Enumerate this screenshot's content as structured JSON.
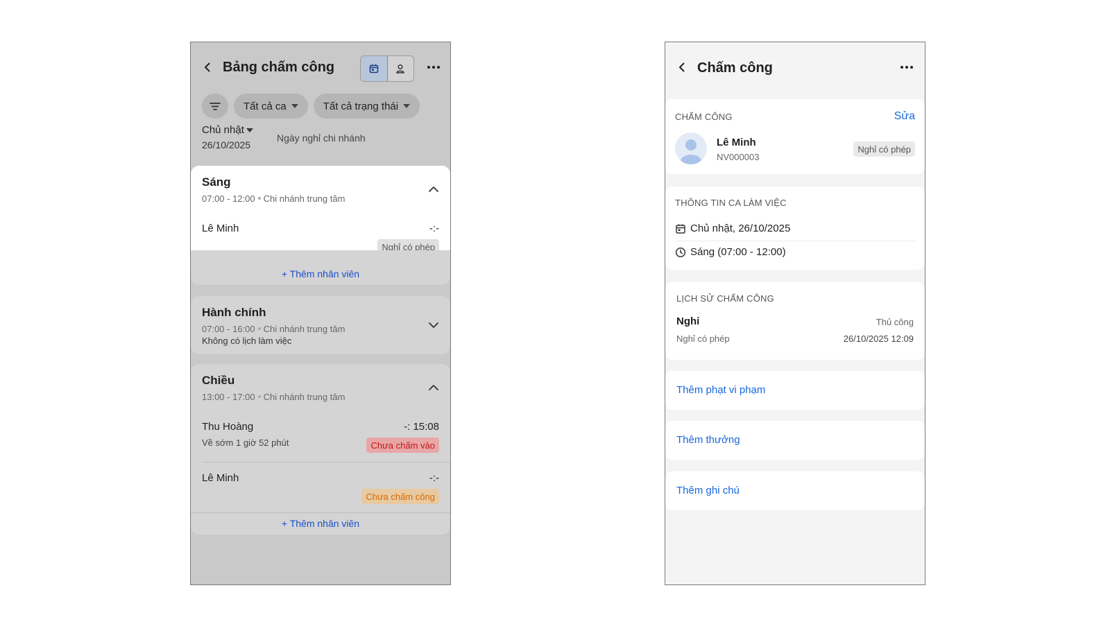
{
  "left": {
    "title": "Bảng chấm công",
    "filters": {
      "shift": "Tất cả ca",
      "status": "Tất cả trạng thái"
    },
    "day": {
      "name": "Chủ nhật",
      "date": "26/10/2025",
      "note": "Ngày nghỉ chi nhánh"
    },
    "shifts": [
      {
        "name": "Sáng",
        "time": "07:00 - 12:00",
        "branch": "Chi nhánh trung tâm",
        "employees": [
          {
            "name": "Lê Minh",
            "time": "-:-",
            "badge": "Nghỉ có phép"
          }
        ],
        "add_label": "+ Thêm nhân viên"
      },
      {
        "name": "Hành chính",
        "time": "07:00 - 16:00",
        "branch": "Chi nhánh trung tâm",
        "note": "Không có lịch làm việc"
      },
      {
        "name": "Chiều",
        "time": "13:00 - 17:00",
        "branch": "Chi nhánh trung tâm",
        "employees": [
          {
            "name": "Thu Hoàng",
            "time": "-: 15:08",
            "sub": "Về sớm 1 giờ 52 phút",
            "badge": "Chưa chấm vào"
          },
          {
            "name": "Lê Minh",
            "time": "-:-",
            "badge": "Chưa chấm công"
          }
        ],
        "add_label": "+ Thêm nhân viên"
      }
    ]
  },
  "right": {
    "title": "Chấm công",
    "attendance": {
      "section": "CHẤM CÔNG",
      "edit": "Sửa",
      "name": "Lê Minh",
      "code": "NV000003",
      "badge": "Nghỉ có phép"
    },
    "shift_info": {
      "section": "THÔNG TIN CA LÀM VIỆC",
      "date": "Chủ nhật, 26/10/2025",
      "shift": "Sáng (07:00 - 12:00)"
    },
    "history": {
      "section": "LỊCH SỬ CHẤM CÔNG",
      "type": "Nghỉ",
      "method": "Thủ công",
      "detail": "Nghỉ có phép",
      "timestamp": "26/10/2025 12:09"
    },
    "actions": {
      "penalty": "Thêm phạt vi phạm",
      "bonus": "Thêm thưởng",
      "note": "Thêm ghi chú"
    }
  },
  "colors": {
    "link": "#1668dc",
    "danger": "#c21818",
    "warning": "#d46b08"
  }
}
